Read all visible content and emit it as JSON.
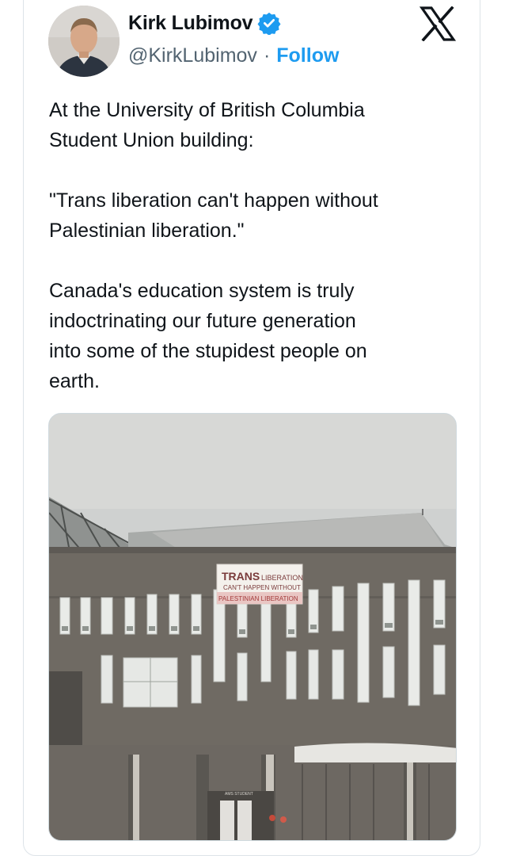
{
  "author": {
    "display_name": "Kirk Lubimov",
    "handle": "@KirkLubimov",
    "separator": "·",
    "follow_label": "Follow",
    "verified": true,
    "verified_color": "#1d9bf0"
  },
  "platform": {
    "logo": "x-logo-icon"
  },
  "tweet": {
    "paragraphs": [
      "At the University of British Columbia\nStudent Union building:",
      "\"Trans liberation can't happen without\nPalestinian liberation.\"",
      "Canada's education system is truly\nindoctrinating our future generation\ninto some of the stupidest people on\nearth."
    ]
  },
  "media": {
    "banner": {
      "line1a": "TRANS",
      "line1b": "LIBERATION",
      "line2": "CAN'T HAPPEN WITHOUT",
      "line3": "PALESTINIAN LIBERATION"
    },
    "sign_text": "AMS STUDENT"
  },
  "colors": {
    "text": "#0f1419",
    "secondary": "#536471",
    "accent": "#1d9bf0",
    "border": "#dde3e8"
  }
}
